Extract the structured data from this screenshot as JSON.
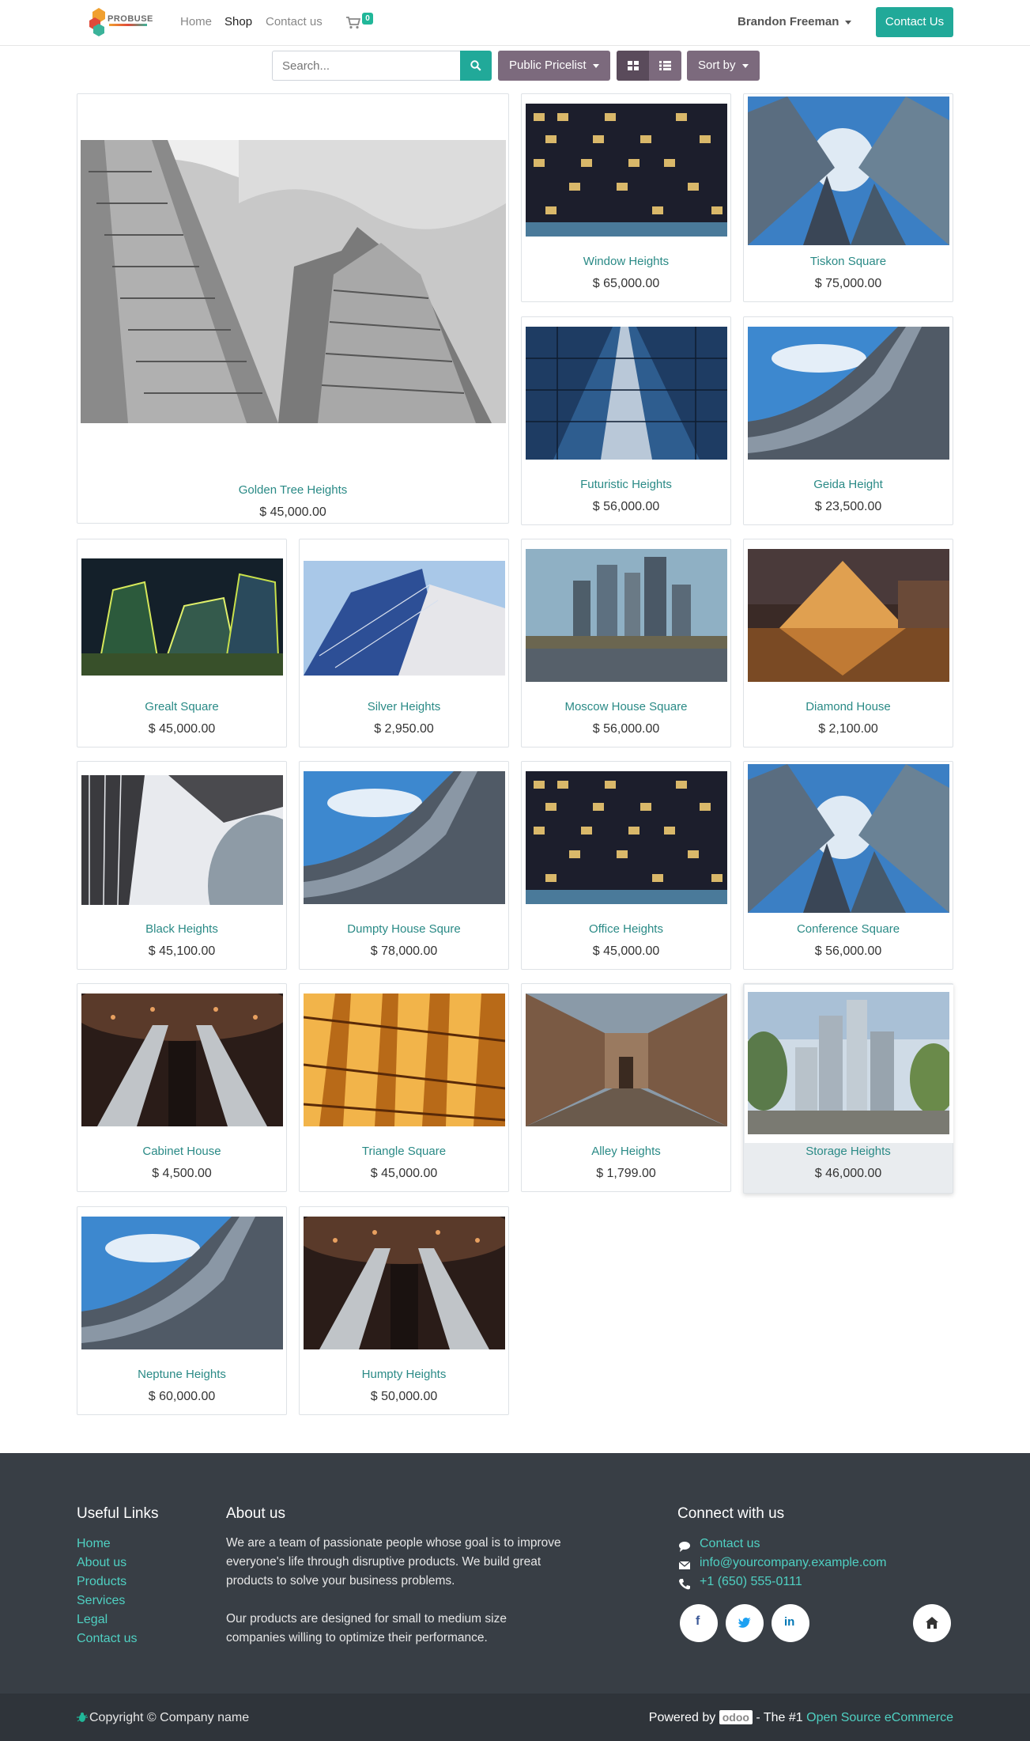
{
  "header": {
    "logo_text": "PROBUSE",
    "nav": [
      {
        "label": "Home"
      },
      {
        "label": "Shop"
      },
      {
        "label": "Contact us"
      }
    ],
    "cart_count": "0",
    "user_name": "Brandon Freeman",
    "contact_button": "Contact Us"
  },
  "toolbar": {
    "search_placeholder": "Search...",
    "pricelist_label": "Public Pricelist",
    "sort_label": "Sort by"
  },
  "products": [
    {
      "name": "Golden Tree Heights",
      "price": "$ 45,000.00"
    },
    {
      "name": "Window Heights",
      "price": "$ 65,000.00"
    },
    {
      "name": "Tiskon Square",
      "price": "$ 75,000.00"
    },
    {
      "name": "Futuristic Heights",
      "price": "$ 56,000.00"
    },
    {
      "name": "Geida Height",
      "price": "$ 23,500.00"
    },
    {
      "name": "Grealt Square",
      "price": "$ 45,000.00"
    },
    {
      "name": "Silver Heights",
      "price": "$ 2,950.00"
    },
    {
      "name": "Moscow House Square",
      "price": "$ 56,000.00"
    },
    {
      "name": "Diamond House",
      "price": "$ 2,100.00"
    },
    {
      "name": "Black Heights",
      "price": "$ 45,100.00"
    },
    {
      "name": "Dumpty House Squre",
      "price": "$ 78,000.00"
    },
    {
      "name": "Office Heights",
      "price": "$ 45,000.00"
    },
    {
      "name": "Conference Square",
      "price": "$ 56,000.00"
    },
    {
      "name": "Cabinet House",
      "price": "$ 4,500.00"
    },
    {
      "name": "Triangle Square",
      "price": "$ 45,000.00"
    },
    {
      "name": "Alley Heights",
      "price": "$ 1,799.00"
    },
    {
      "name": "Storage Heights",
      "price": "$ 46,000.00"
    },
    {
      "name": "Neptune Heights",
      "price": "$ 60,000.00"
    },
    {
      "name": "Humpty Heights",
      "price": "$ 50,000.00"
    }
  ],
  "footer": {
    "useful_links_title": "Useful Links",
    "useful_links": [
      "Home",
      "About us",
      "Products",
      "Services",
      "Legal",
      "Contact us"
    ],
    "about_title": "About us",
    "about_p1_l1": "We are a team of passionate people whose goal is to improve",
    "about_p1_l2": "everyone's life through disruptive products. We build great",
    "about_p1_l3": "products to solve your business problems.",
    "about_p2_l1": "Our products are designed for small to medium size",
    "about_p2_l2": "companies willing to optimize their performance.",
    "connect_title": "Connect with us",
    "contact_link": "Contact us",
    "email": "info@yourcompany.example.com",
    "phone": "+1 (650) 555-0111",
    "copyright": "Copyright © Company name",
    "powered_by": "Powered by",
    "odoo": "odoo",
    "tagline": "- The #1",
    "oss_link": "Open Source eCommerce"
  },
  "colors": {
    "accent": "#21a999",
    "button_grey": "#7c6a7d",
    "footer_bg": "#383e45",
    "link": "#2a8a86"
  }
}
